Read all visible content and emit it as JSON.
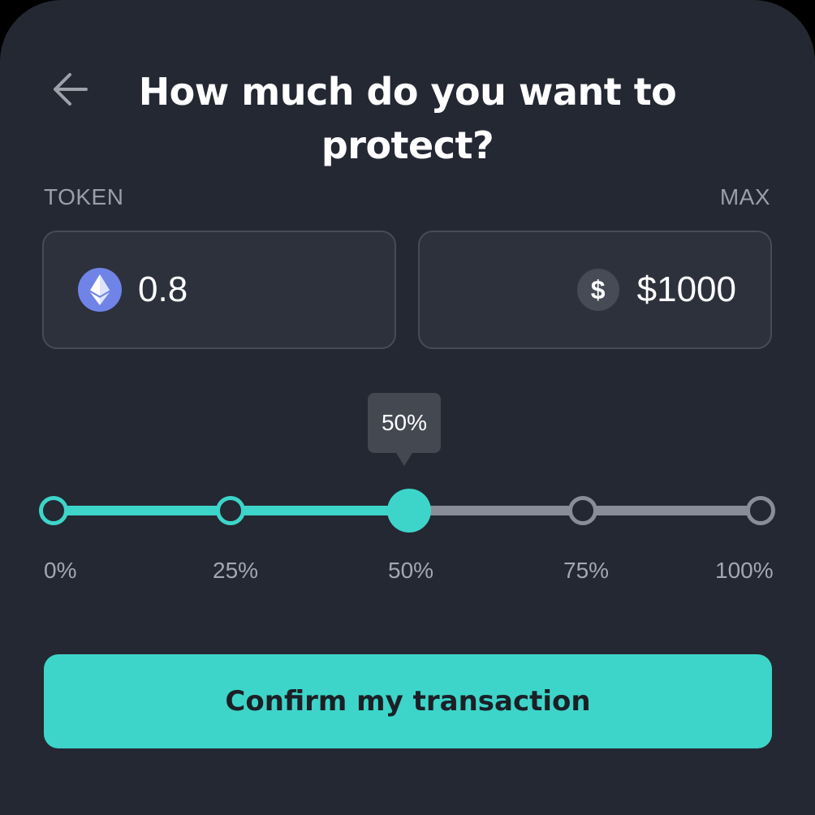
{
  "header": {
    "title": "How much do you want to protect?",
    "back_icon": "arrow-left-icon"
  },
  "labels": {
    "token": "TOKEN",
    "max": "MAX"
  },
  "token_field": {
    "icon": "ethereum-icon",
    "value": "0.8"
  },
  "usd_field": {
    "icon": "dollar-icon",
    "icon_glyph": "$",
    "value": "$1000"
  },
  "slider": {
    "tooltip": "50%",
    "value_percent": 50,
    "stops": [
      "0%",
      "25%",
      "50%",
      "75%",
      "100%"
    ]
  },
  "confirm_button": {
    "label": "Confirm my transaction"
  },
  "colors": {
    "background": "#242833",
    "accent": "#3dd5c9",
    "field": "#2d313c",
    "muted": "#8a8d97",
    "ethereum": "#6f84e6"
  }
}
